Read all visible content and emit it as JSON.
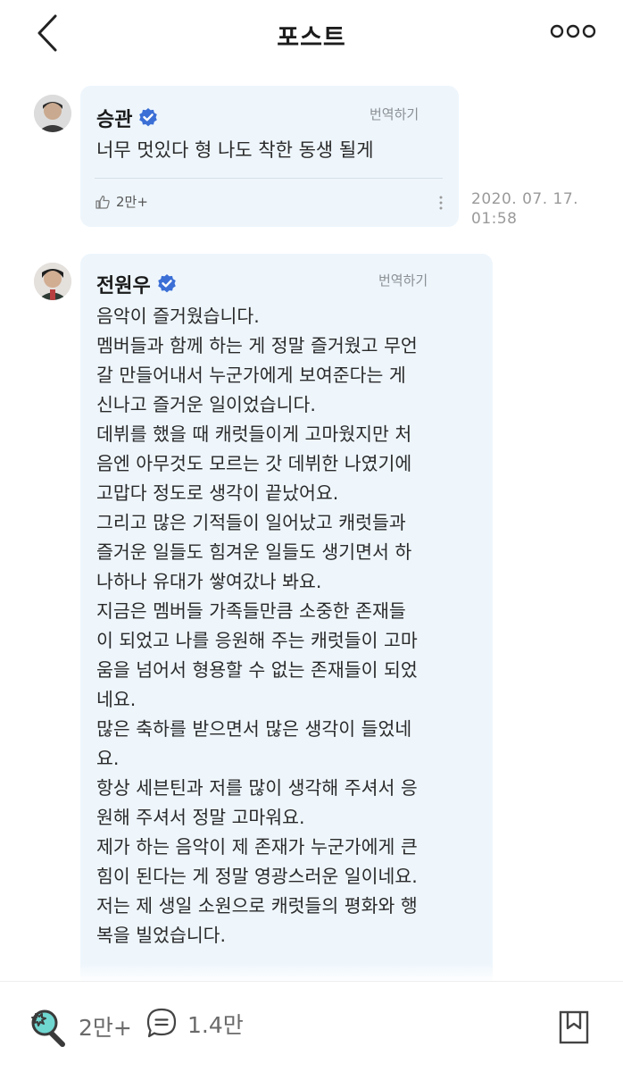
{
  "header": {
    "title": "포스트",
    "back_icon": "chevron-left-icon",
    "more_icon": "more-horizontal-icon"
  },
  "comments": [
    {
      "author": "승관",
      "verified": true,
      "translate_label": "번역하기",
      "text": "너무 멋있다 형 나도 착한 동생 될게",
      "likes": "2만+",
      "timestamp": "2020. 07. 17.\n01:58"
    },
    {
      "author": "전원우",
      "verified": true,
      "translate_label": "번역하기",
      "text": "음악이 즐거웠습니다.\n멤버들과 함께 하는 게 정말 즐거웠고 무언\n갈 만들어내서 누군가에게 보여준다는 게\n신나고 즐거운 일이었습니다.\n데뷔를 했을 때 캐럿들이게 고마웠지만 처\n음엔 아무것도 모르는 갓 데뷔한 나였기에\n고맙다 정도로 생각이 끝났어요.\n그리고 많은 기적들이 일어났고 캐럿들과\n즐거운 일들도 힘겨운 일들도 생기면서 하\n나하나 유대가 쌓여갔나 봐요.\n지금은 멤버들 가족들만큼 소중한 존재들\n이 되었고 나를 응원해 주는 캐럿들이 고마\n움을 넘어서 형용할 수 없는 존재들이 되었\n네요.\n많은 축하를 받으면서 많은 생각이 들었네\n요.\n항상 세븐틴과 저를 많이 생각해 주셔서 응\n원해 주셔서 정말 고마워요.\n제가 하는 음악이 제 존재가 누군가에게 큰\n힘이 된다는 게 정말 영광스러운 일이네요.\n저는 제 생일 소원으로 캐럿들의 평화와 행\n복을 빌었습니다."
    }
  ],
  "footer": {
    "like_count": "2만+",
    "comment_count": "1.4만",
    "like_icon": "lightstick-icon",
    "comment_icon": "comment-bubble-icon",
    "bookmark_icon": "bookmark-icon"
  },
  "colors": {
    "bubble_bg": "#eef6fc",
    "verified_blue": "#3b6fd6",
    "lightstick_teal": "#6fd6d0"
  }
}
